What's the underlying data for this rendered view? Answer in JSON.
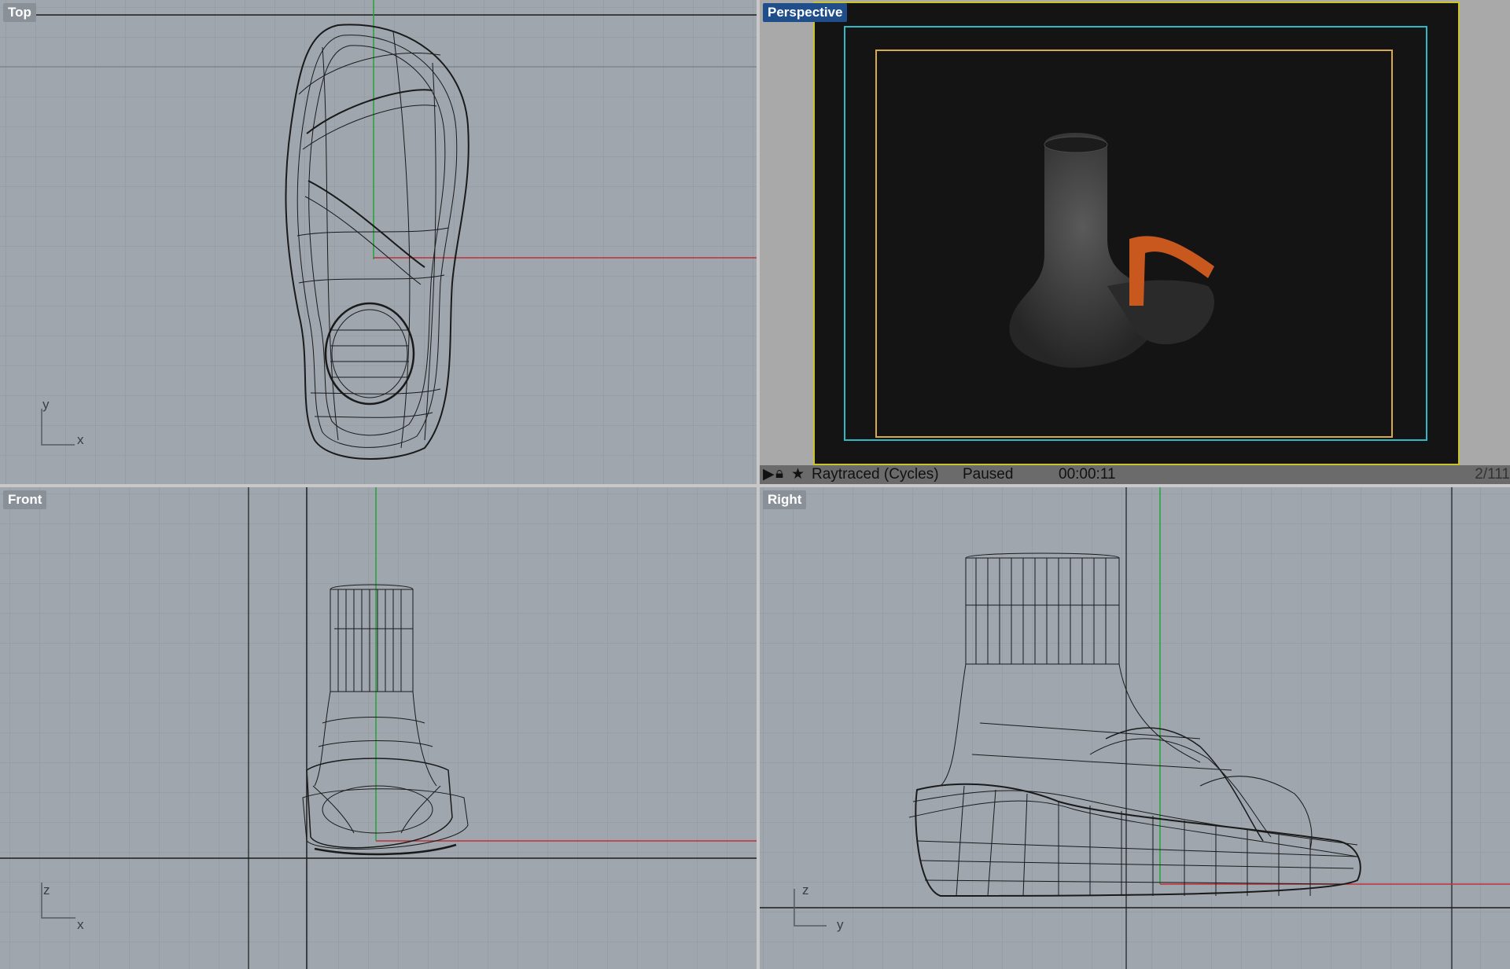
{
  "viewports": {
    "top": {
      "label": "Top",
      "axes": {
        "a": "y",
        "b": "x"
      }
    },
    "perspective": {
      "label": "Perspective",
      "status": {
        "renderer": "Raytraced (Cycles)",
        "state": "Paused",
        "time": "00:00:11",
        "pass": "2/111"
      },
      "icons": [
        "play-icon",
        "lock-icon",
        "star-icon"
      ]
    },
    "front": {
      "label": "Front",
      "axes": {
        "a": "z",
        "b": "x"
      }
    },
    "right": {
      "label": "Right",
      "axes": {
        "a": "z",
        "b": "y"
      }
    }
  },
  "colors": {
    "viewport_bg": "#9fa6ae",
    "active_label": "#1f4e8a",
    "x_axis": "#c0313a",
    "y_axis": "#22a33a",
    "safe_frame_outer": "#c9c42a",
    "safe_frame_mid": "#2fb8c8",
    "safe_frame_inner": "#d8a84a",
    "strap": "#c9581f"
  }
}
